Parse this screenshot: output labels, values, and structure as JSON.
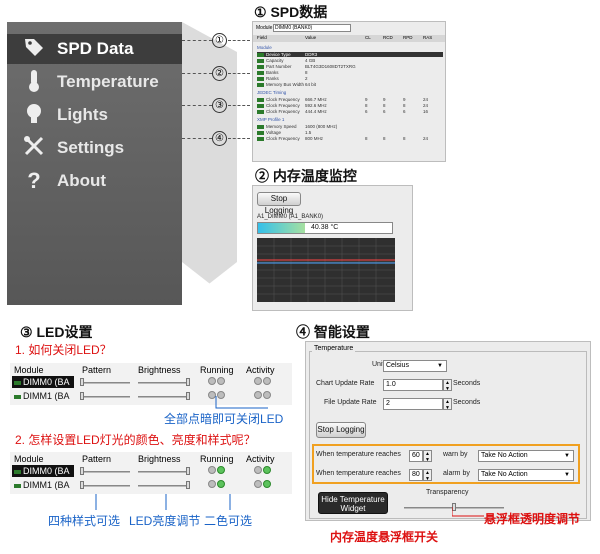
{
  "sidebar": {
    "items": [
      {
        "label": "SPD Data",
        "icon": "tag-icon"
      },
      {
        "label": "Temperature",
        "icon": "thermometer-icon"
      },
      {
        "label": "Lights",
        "icon": "lightbulb-icon"
      },
      {
        "label": "Settings",
        "icon": "tools-icon"
      },
      {
        "label": "About",
        "icon": "question-icon"
      }
    ]
  },
  "callouts": [
    "①",
    "②",
    "③",
    "④"
  ],
  "spd": {
    "title": "① SPD数据",
    "module_label": "Module",
    "module_value": "DIMM0 (BANK0)",
    "headers": [
      "Field",
      "Value",
      "CL",
      "RCD",
      "RPD",
      "RAS"
    ],
    "section_module": "Module",
    "rows": [
      {
        "f": "Device Type",
        "v": "DDR3"
      },
      {
        "f": "Capacity",
        "v": "4 GB"
      },
      {
        "f": "Part Number",
        "v": "BLT4G3D1608DT2TXRG"
      },
      {
        "f": "Banks",
        "v": "8"
      },
      {
        "f": "Ranks",
        "v": "2"
      },
      {
        "f": "Memory Bus Width",
        "v": "64 bit"
      }
    ],
    "section_jedec": "JEDEC Timing",
    "jedec": [
      {
        "f": "Clock Frequency",
        "v": "666.7 MHz",
        "cl": "9",
        "rcd": "9",
        "rpd": "9",
        "ras": "24"
      },
      {
        "f": "Clock Frequency",
        "v": "592.6 MHz",
        "cl": "8",
        "rcd": "8",
        "rpd": "8",
        "ras": "24"
      },
      {
        "f": "Clock Frequency",
        "v": "444.4 MHz",
        "cl": "6",
        "rcd": "6",
        "rpd": "6",
        "ras": "16"
      }
    ],
    "section_xmp": "XMP Profile 1",
    "xmp": [
      {
        "f": "Memory Speed",
        "v": "1600 (800 MHz)",
        "cl": "",
        "rcd": "",
        "rpd": "",
        "ras": ""
      },
      {
        "f": "Voltage",
        "v": "1.5",
        "cl": "",
        "rcd": "",
        "rpd": "",
        "ras": ""
      },
      {
        "f": "Clock Frequency",
        "v": "800 MHz",
        "cl": "8",
        "rcd": "8",
        "rpd": "8",
        "ras": "24"
      }
    ]
  },
  "temp": {
    "title": "② 内存温度监控",
    "button": "Stop Logging",
    "dimm": "A1_DIMM0 (A1_BANK0)",
    "value": "40.38 °C",
    "fill_fraction": 0.35
  },
  "led": {
    "title": "③ LED设置",
    "q1": "1. 如何关闭LED？",
    "headers": [
      "Module",
      "Pattern",
      "Brightness",
      "Running",
      "Activity"
    ],
    "rows1": [
      "DIMM0 (BA",
      "DIMM1 (BA"
    ],
    "note1": "全部点暗即可关闭LED",
    "q2": "2. 怎样设置LED灯光的颜色、亮度和样式呢？",
    "rows2": [
      "DIMM0 (BA",
      "DIMM1 (BA"
    ],
    "note_pattern": "四种样式可选",
    "note_brightness": "LED亮度调节",
    "note_color": "二色可选"
  },
  "settings": {
    "title": "④ 智能设置",
    "group": "Temperature",
    "unit_label": "Unit *",
    "unit_value": "Celsius",
    "chart_rate_label": "Chart Update Rate",
    "chart_rate_value": "1.0",
    "seconds": "Seconds",
    "file_rate_label": "File Update Rate",
    "file_rate_value": "2",
    "stop_button": "Stop Logging",
    "warn_label": "When temperature reaches",
    "warn_value": "60",
    "warn_by": "warn by",
    "warn_action": "Take No Action",
    "alarm_label": "When temperature reaches",
    "alarm_value": "80",
    "alarm_by": "alarm by",
    "alarm_action": "Take No Action",
    "hide_button": "Hide Temperature Widget",
    "transparency": "Transparency",
    "note_transparency": "悬浮框透明度调节",
    "note_widget": "内存温度悬浮框开关"
  }
}
